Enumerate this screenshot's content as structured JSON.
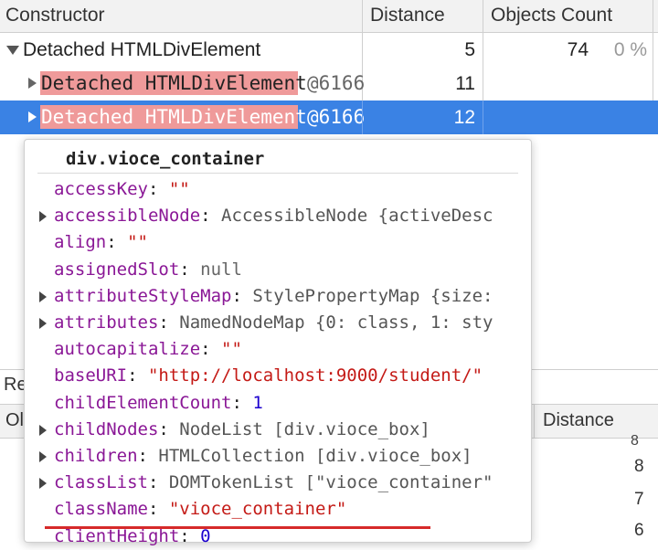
{
  "header": {
    "constructor": "Constructor",
    "distance": "Distance",
    "objects_count": "Objects Count"
  },
  "rows": [
    {
      "name": "Detached HTMLDivElement",
      "distance": "5",
      "count": "74",
      "percent": "0 %"
    },
    {
      "name": "Detached HTMLDivElement",
      "id": "@6166",
      "distance": "11"
    },
    {
      "name": "Detached HTMLDivElement",
      "id": "@6166",
      "distance": "12"
    }
  ],
  "lower": {
    "tab_fragment": "Re",
    "col_fragment": "Ol",
    "distance": "Distance",
    "values": [
      "8",
      "7",
      "6"
    ],
    "partial": "8"
  },
  "popover": {
    "title": "div.vioce_container",
    "props": [
      {
        "key": "accessKey",
        "val": "\"\"",
        "type": "string"
      },
      {
        "key": "accessibleNode",
        "val": "AccessibleNode {activeDesc",
        "type": "object",
        "expand": true
      },
      {
        "key": "align",
        "val": "\"\"",
        "type": "string"
      },
      {
        "key": "assignedSlot",
        "val": "null",
        "type": "null"
      },
      {
        "key": "attributeStyleMap",
        "val": "StylePropertyMap {size:",
        "type": "object",
        "expand": true
      },
      {
        "key": "attributes",
        "val": "NamedNodeMap {0: class, 1: sty",
        "type": "object",
        "expand": true
      },
      {
        "key": "autocapitalize",
        "val": "\"\"",
        "type": "string"
      },
      {
        "key": "baseURI",
        "val": "\"http://localhost:9000/student/\"",
        "type": "string"
      },
      {
        "key": "childElementCount",
        "val": "1",
        "type": "number"
      },
      {
        "key": "childNodes",
        "val": "NodeList [div.vioce_box]",
        "type": "object",
        "expand": true
      },
      {
        "key": "children",
        "val": "HTMLCollection [div.vioce_box]",
        "type": "object",
        "expand": true
      },
      {
        "key": "classList",
        "val": "DOMTokenList [\"vioce_container\"",
        "type": "object",
        "expand": true
      },
      {
        "key": "className",
        "val": "\"vioce_container\"",
        "type": "string"
      },
      {
        "key": "clientHeight",
        "val": "0",
        "type": "number"
      }
    ]
  },
  "colors": {
    "selection": "#3a82e4",
    "highlight": "#ef9a9a",
    "prop_key": "#8a1796",
    "string": "#c41a16",
    "underline": "#d62a2a"
  }
}
